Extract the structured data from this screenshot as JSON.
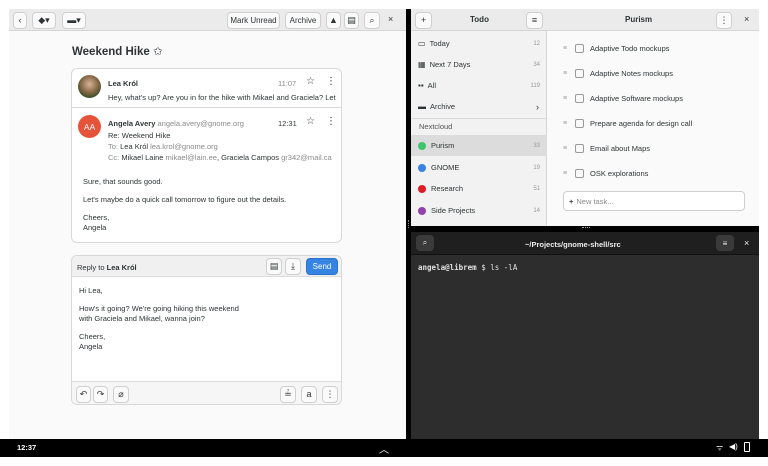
{
  "mail": {
    "toolbar": {
      "mark_unread": "Mark Unread",
      "archive": "Archive"
    },
    "thread_title": "Weekend Hike ✩",
    "messages": [
      {
        "sender": "Lea Król",
        "time": "11:07",
        "preview": "Hey, what's up? Are you in for the hike with Mikael and Graciela? Let..."
      },
      {
        "sender": "Angela Avery",
        "sender_email": "angela.avery@gnome.org",
        "time": "12:31",
        "initials": "AA",
        "subject": "Re: Weekend Hike",
        "to_label": "To:",
        "to_name": "Lea Król",
        "to_email": "lea.krol@gnome.org",
        "cc_label": "Cc:",
        "cc_name1": "Mikael Laine",
        "cc_email1": "mikael@lain.ee",
        "cc_name2": ", Graciela Campos",
        "cc_email2": "gr342@mail.ca",
        "body1": "Sure, that sounds good.",
        "body2": "Let's maybe do a quick call tomorrow to figure out the details.",
        "body3": "Cheers,",
        "body4": "Angela"
      }
    ],
    "reply": {
      "label": "Reply to",
      "recipient": "Lea Król",
      "send": "Send",
      "line1": "Hi Lea,",
      "line2": "How's it going? We're going hiking this weekend",
      "line3": "with Graciela and Mikael, wanna join?",
      "line4": "Cheers,",
      "line5": "Angela"
    }
  },
  "todo": {
    "title": "Todo",
    "nav": [
      {
        "label": "Today",
        "count": "12",
        "icon": "calendar-icon"
      },
      {
        "label": "Next 7 Days",
        "count": "34",
        "icon": "calendar-week-icon"
      },
      {
        "label": "All",
        "count": "119",
        "icon": "grid-icon"
      },
      {
        "label": "Archive",
        "count": "",
        "icon": "folder-icon"
      }
    ],
    "section": "Nextcloud",
    "lists": [
      {
        "label": "Purism",
        "count": "33",
        "color": "#3ec46d"
      },
      {
        "label": "GNOME",
        "count": "19",
        "color": "#3584e4"
      },
      {
        "label": "Research",
        "count": "51",
        "color": "#e01b24"
      },
      {
        "label": "Side Projects",
        "count": "14",
        "color": "#9141ac"
      }
    ],
    "list_title": "Purism",
    "tasks": [
      "Adaptive Todo mockups",
      "Adaptive Notes mockups",
      "Adaptive Software mockups",
      "Prepare agenda for design call",
      "Email about Maps",
      "OSK explorations"
    ],
    "new_task_placeholder": "New task..."
  },
  "terminal": {
    "title": "~/Projects/gnome-shell/src",
    "prompt": "angela@librem",
    "command": "$ ls -lA"
  },
  "panel": {
    "clock": "12:37"
  },
  "colors": {
    "accent": "#3584e4",
    "avatar_red": "#e5533b",
    "terminal_bg": "#2d2d2d",
    "panel_bg": "#000000"
  }
}
